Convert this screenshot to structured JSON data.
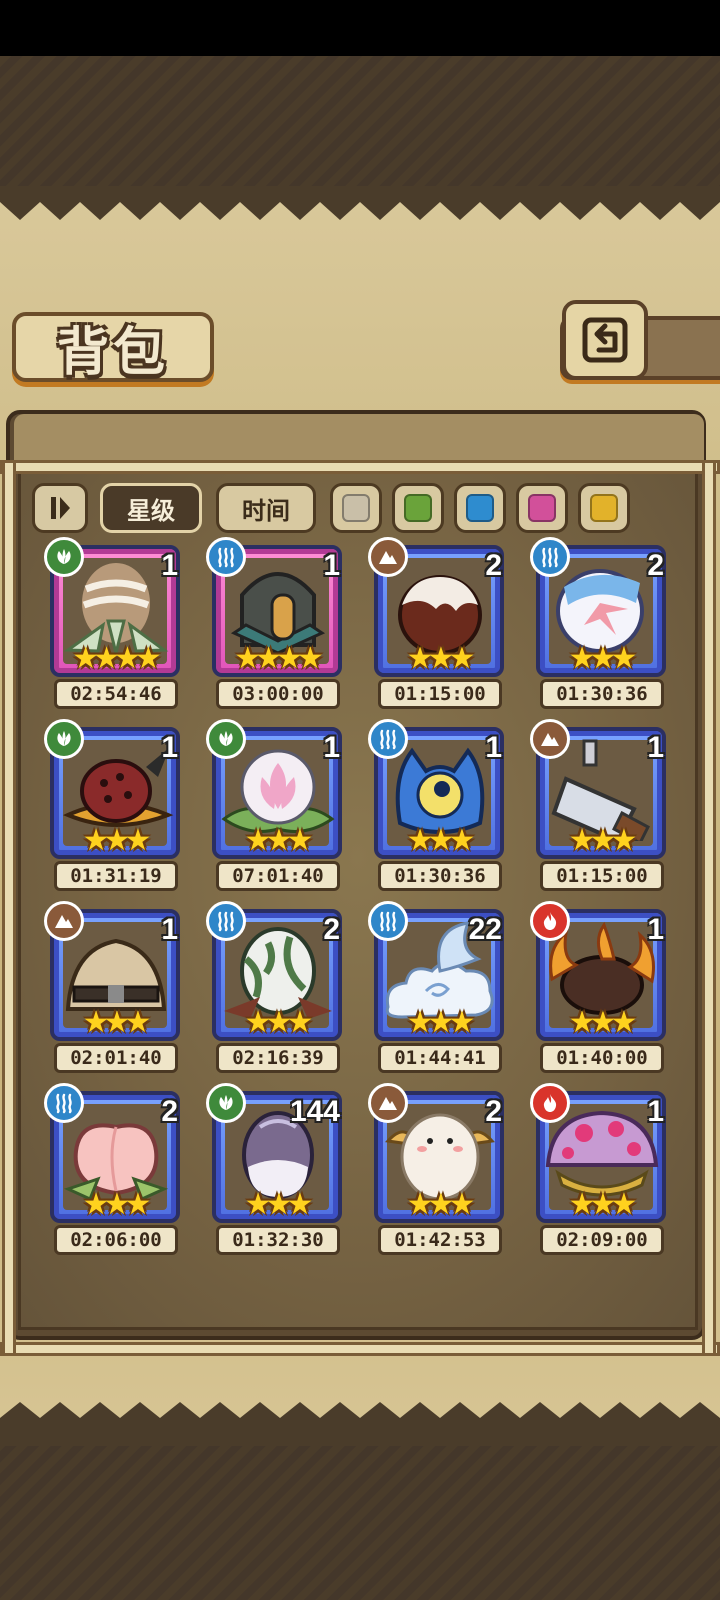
{
  "title": "背包",
  "filters": {
    "order_icon": "sort-order-icon",
    "star_label": "星级",
    "time_label": "时间",
    "colors": [
      "#c9bfa8",
      "#6aa33a",
      "#2e8ccf",
      "#d2509a",
      "#e2b22a"
    ]
  },
  "items": [
    {
      "element": "grass",
      "rarity": "pink",
      "stars": 4,
      "count": "1",
      "time": "02:54:46",
      "art": "striped-egg-in-leaves"
    },
    {
      "element": "water",
      "rarity": "pink",
      "stars": 4,
      "count": "1",
      "time": "03:00:00",
      "art": "armored-helmet"
    },
    {
      "element": "earth",
      "rarity": "blue",
      "stars": 3,
      "count": "2",
      "time": "01:15:00",
      "art": "chocolate-dessert"
    },
    {
      "element": "water",
      "rarity": "blue",
      "stars": 3,
      "count": "2",
      "time": "01:30:36",
      "art": "white-egg-with-ribbon"
    },
    {
      "element": "grass",
      "rarity": "blue",
      "stars": 3,
      "count": "1",
      "time": "01:31:19",
      "art": "spotted-hat"
    },
    {
      "element": "grass",
      "rarity": "blue",
      "stars": 3,
      "count": "1",
      "time": "07:01:40",
      "art": "lotus-bubble"
    },
    {
      "element": "water",
      "rarity": "blue",
      "stars": 3,
      "count": "1",
      "time": "01:30:36",
      "art": "one-eyed-blob"
    },
    {
      "element": "earth",
      "rarity": "blue",
      "stars": 3,
      "count": "1",
      "time": "01:15:00",
      "art": "cleaver-on-chain"
    },
    {
      "element": "earth",
      "rarity": "blue",
      "stars": 3,
      "count": "1",
      "time": "02:01:40",
      "art": "furry-hat"
    },
    {
      "element": "water",
      "rarity": "blue",
      "stars": 3,
      "count": "2",
      "time": "02:16:39",
      "art": "vine-egg"
    },
    {
      "element": "water",
      "rarity": "blue",
      "stars": 3,
      "count": "22",
      "time": "01:44:41",
      "art": "cloud-wing"
    },
    {
      "element": "fire",
      "rarity": "blue",
      "stars": 3,
      "count": "1",
      "time": "01:40:00",
      "art": "flame-beast"
    },
    {
      "element": "water",
      "rarity": "blue",
      "stars": 3,
      "count": "2",
      "time": "02:06:00",
      "art": "peach"
    },
    {
      "element": "grass",
      "rarity": "blue",
      "stars": 3,
      "count": "144",
      "time": "01:32:30",
      "art": "purple-egg"
    },
    {
      "element": "earth",
      "rarity": "blue",
      "stars": 3,
      "count": "2",
      "time": "01:42:53",
      "art": "fluffy-sheep"
    },
    {
      "element": "fire",
      "rarity": "blue",
      "stars": 3,
      "count": "1",
      "time": "02:09:00",
      "art": "spotted-mushroom"
    }
  ]
}
